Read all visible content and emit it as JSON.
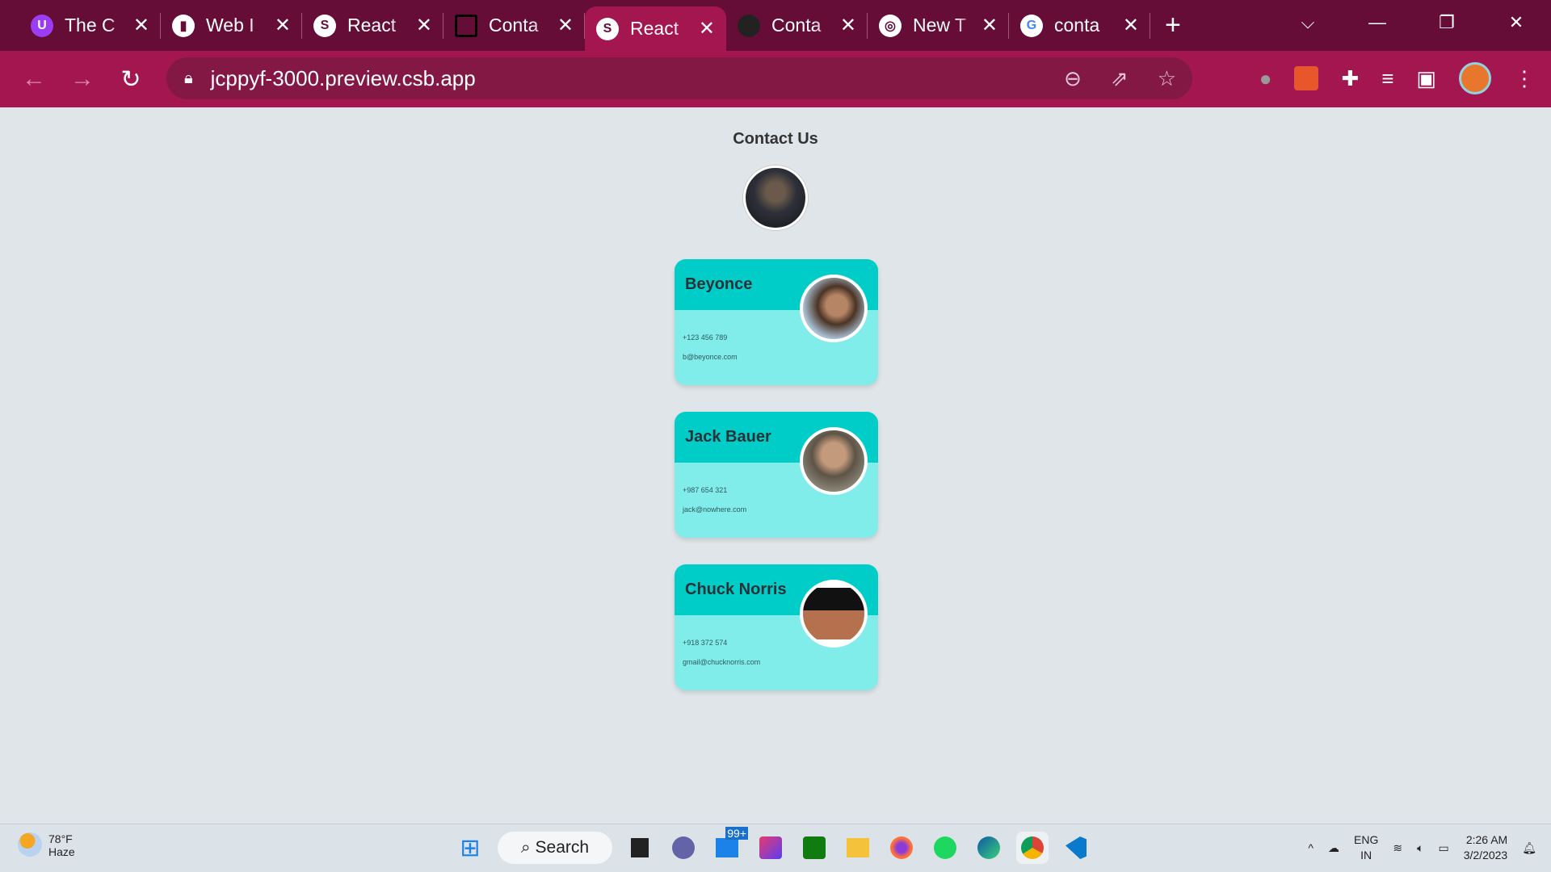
{
  "browser": {
    "tabs": [
      {
        "title": "The C",
        "icon": "u-icon",
        "color": "#9b3df5"
      },
      {
        "title": "Web I",
        "icon": "phone-icon",
        "color": "#f4c430"
      },
      {
        "title": "React",
        "icon": "codesandbox-icon",
        "color": "#ffffff"
      },
      {
        "title": "Conta",
        "icon": "square-icon",
        "color": "#000000"
      },
      {
        "title": "React",
        "icon": "codesandbox-icon",
        "color": "#ffffff",
        "active": true
      },
      {
        "title": "Conta",
        "icon": "github-icon",
        "color": "#222222"
      },
      {
        "title": "New T",
        "icon": "chrome-icon",
        "color": "#ffffff"
      },
      {
        "title": "conta",
        "icon": "google-icon",
        "color": "#ffffff"
      }
    ],
    "url": "jcppyf-3000.preview.csb.app"
  },
  "page": {
    "title": "Contact Us",
    "contacts": [
      {
        "name": "Beyonce",
        "phone": "+123 456 789",
        "email": "b@beyonce.com"
      },
      {
        "name": "Jack Bauer",
        "phone": "+987 654 321",
        "email": "jack@nowhere.com"
      },
      {
        "name": "Chuck Norris",
        "phone": "+918 372 574",
        "email": "gmail@chucknorris.com"
      }
    ]
  },
  "taskbar": {
    "weather": {
      "temp": "78°F",
      "condition": "Haze"
    },
    "search_label": "Search",
    "mail_badge": "99+",
    "lang": "ENG",
    "region": "IN",
    "time": "2:26 AM",
    "date": "3/2/2023"
  },
  "colors": {
    "tabbar": "#650d36",
    "toolbar": "#a3164f",
    "card_header": "#00cdc8",
    "card_body": "#80edeb",
    "background": "#dfe5e8"
  }
}
